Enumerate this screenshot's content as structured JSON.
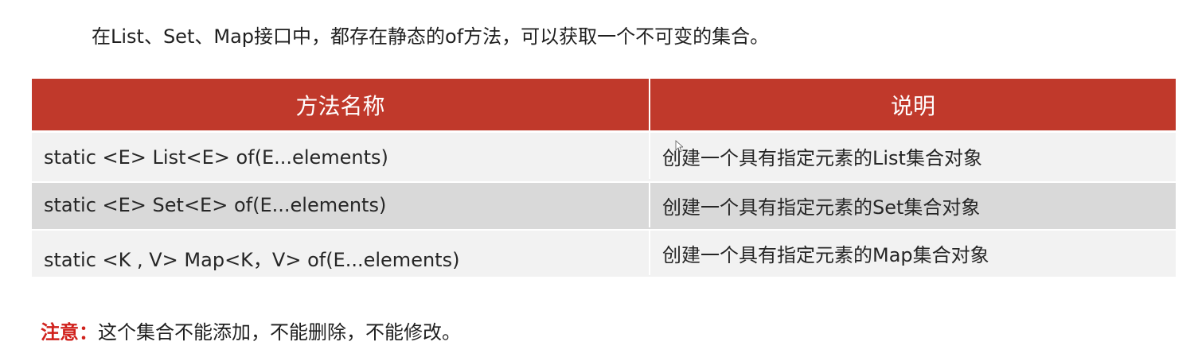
{
  "intro": {
    "text": "在List、Set、Map接口中，都存在静态的of方法，可以获取一个不可变的集合。"
  },
  "table": {
    "headers": [
      "方法名称",
      "说明"
    ],
    "rows": [
      {
        "method": "static <E>  List<E>  of(E...elements)",
        "description": "创建一个具有指定元素的List集合对象"
      },
      {
        "method": "static <E>  Set<E>  of(E...elements)",
        "description": "创建一个具有指定元素的Set集合对象"
      },
      {
        "method": "static <K , V>   Map<K，V>  of(E...elements)",
        "description": "创建一个具有指定元素的Map集合对象"
      }
    ]
  },
  "note": {
    "label": "注意：",
    "text": "这个集合不能添加，不能删除，不能修改。"
  },
  "colors": {
    "header_bg": "#c0392b",
    "row_light": "#f2f2f2",
    "row_dark": "#d9d9d9",
    "note_label": "#d0211c"
  }
}
